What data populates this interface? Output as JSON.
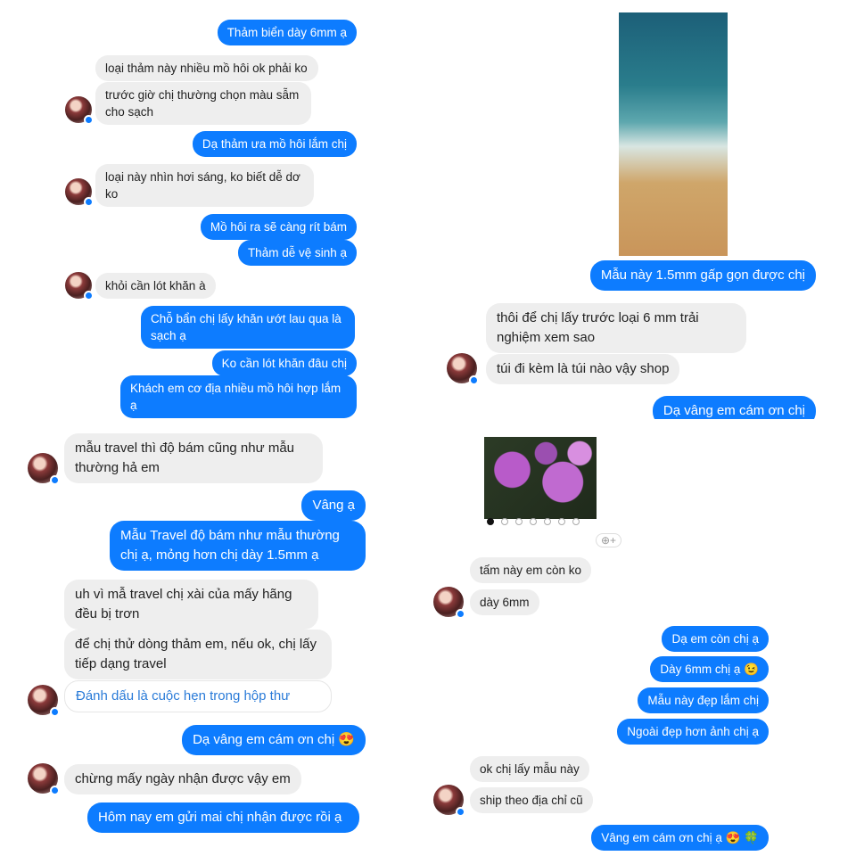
{
  "panel_tl": {
    "messages": [
      "Thảm biển dày 6mm ạ",
      "loại thảm này nhiều mồ hôi ok phải ko",
      "trước giờ chị thường chọn màu sẫm cho sạch",
      "Dạ thảm ưa mồ hôi lắm chị",
      "loại này nhìn hơi sáng, ko biết dễ dơ ko",
      "Mồ hôi ra sẽ càng rít bám",
      "Thảm dễ vệ sinh ạ",
      "khỏi cần lót khăn à",
      "Chỗ bẩn chị lấy khăn ướt lau qua là sạch ạ",
      "Ko cần lót khăn đâu chị",
      "Khách em cơ địa nhiều mồ hôi hợp lắm ạ"
    ]
  },
  "panel_bl": {
    "messages": [
      "mẫu travel thì độ bám cũng như mẫu thường hả em",
      "Vâng ạ",
      "Mẫu Travel độ bám như mẫu thường chị ạ, mỏng hơn chị dày 1.5mm ạ",
      "uh vì mẫ travel chị xài của mấy hãng đều bị trơn",
      "để chị thử dòng thảm em, nếu ok, chị lấy tiếp dạng travel",
      "Đánh dấu là cuộc hẹn trong hộp thư",
      "Dạ vâng em cám ơn chị 😍",
      "chừng mấy ngày nhận được vậy em",
      "Hôm nay em gửi mai chị nhận được rồi ạ"
    ]
  },
  "panel_tr": {
    "messages": [
      "Mẫu này 1.5mm gấp gọn được chị",
      "thôi để chị lấy trước loại 6 mm trải nghiệm xem sao",
      "túi đi kèm là túi nào vậy shop",
      "Dạ vâng em cám ơn chị"
    ]
  },
  "panel_br": {
    "messages": [
      "tấm này em còn ko",
      "dày 6mm",
      "Dạ em còn chị ạ",
      "Dày 6mm chị ạ 😉",
      "Mẫu này đẹp lắm chị",
      "Ngoài đẹp hơn ảnh chị ạ",
      "ok chị lấy mẫu này",
      "ship theo địa chỉ cũ",
      "Vâng em cám ơn chị ạ 😍 🍀"
    ],
    "react_add": "⊕+"
  },
  "colors": {
    "outgoing": "#0d7cff",
    "incoming": "#eeeeee",
    "link": "#2a7bd8"
  }
}
